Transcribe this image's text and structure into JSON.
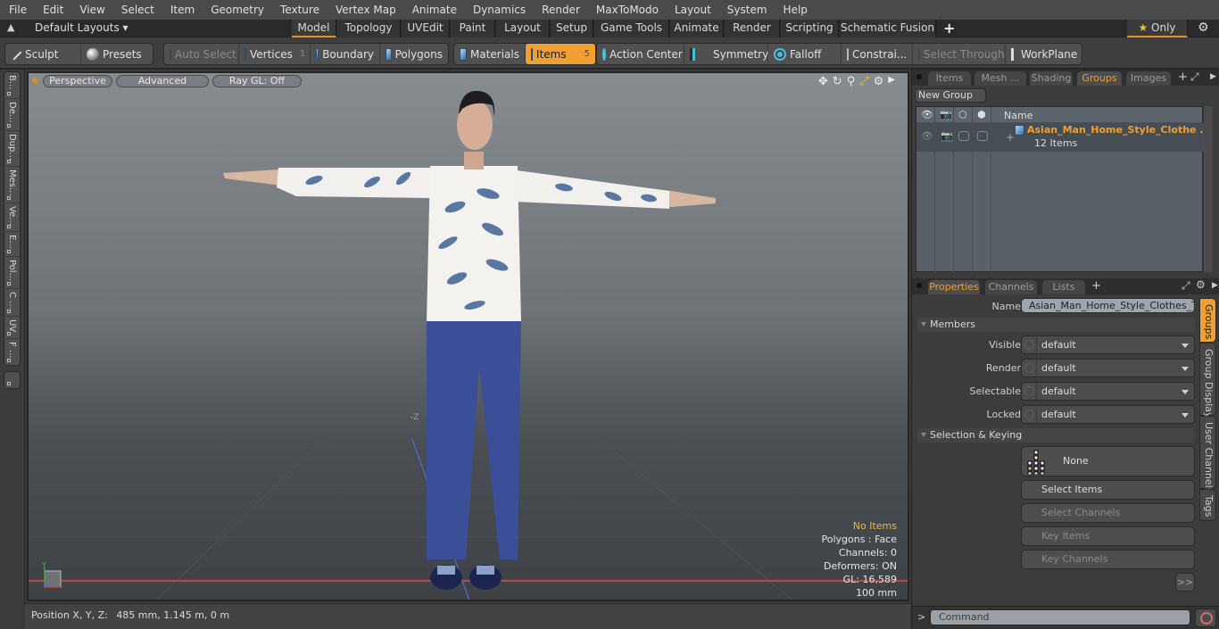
{
  "menu": [
    "File",
    "Edit",
    "View",
    "Select",
    "Item",
    "Geometry",
    "Texture",
    "Vertex Map",
    "Animate",
    "Dynamics",
    "Render",
    "MaxToModo",
    "Layout",
    "System",
    "Help"
  ],
  "layoutbar": {
    "layouts_label": "Default Layouts",
    "tabs": [
      "Model",
      "Topology",
      "UVEdit",
      "Paint",
      "Layout",
      "Setup",
      "Game Tools",
      "Animate",
      "Render",
      "Scripting",
      "Schematic Fusion"
    ],
    "active_tab": "Model",
    "add_label": "+",
    "only_label": "Only"
  },
  "toolbar": {
    "sculpt": "Sculpt",
    "presets": "Presets",
    "auto_select": "Auto Select",
    "vertices": "Vertices",
    "vertices_count": "1",
    "boundary": "Boundary",
    "polygons": "Polygons",
    "materials": "Materials",
    "items": "Items",
    "items_count": "5",
    "action_center": "Action Center",
    "symmetry": "Symmetry",
    "falloff": "Falloff",
    "constraints": "Constrai...",
    "select_through": "Select Through",
    "workplane": "WorkPlane"
  },
  "left_tabs": [
    "B...",
    "De...",
    "Dup...",
    "Mes...",
    "Ve...",
    "E...",
    "Pol...",
    "C ...",
    "UV",
    "F ..."
  ],
  "viewport": {
    "perspective": "Perspective",
    "advanced": "Advanced",
    "raygl": "Ray GL: Off",
    "axis_label": "-Z",
    "hud": {
      "selection": "No Items",
      "polygons": "Polygons : Face",
      "channels": "Channels: 0",
      "deformers": "Deformers: ON",
      "gl": "GL: 16,589",
      "scale": "100 mm"
    }
  },
  "status": {
    "position_label": "Position X, Y, Z:",
    "position_value": "485 mm, 1.145 m, 0 m"
  },
  "top_panel": {
    "tabs": [
      "Items",
      "Mesh ...",
      "Shading",
      "Groups",
      "Images"
    ],
    "active_tab": "Groups",
    "new_group": "New Group",
    "name_header": "Name",
    "group_name": "Asian_Man_Home_Style_Clothe ...",
    "group_count": "12 Items"
  },
  "properties_panel": {
    "tabs": [
      "Properties",
      "Channels",
      "Lists"
    ],
    "active_tab": "Properties",
    "name_label": "Name",
    "name_value": "Asian_Man_Home_Style_Clothes_T_P",
    "members_section": "Members",
    "fields": [
      {
        "label": "Visible",
        "value": "default"
      },
      {
        "label": "Render",
        "value": "default"
      },
      {
        "label": "Selectable",
        "value": "default"
      },
      {
        "label": "Locked",
        "value": "default"
      }
    ],
    "selection_section": "Selection & Keying",
    "none_label": "None",
    "select_items": "Select Items",
    "select_channels": "Select Channels",
    "key_items": "Key Items",
    "key_channels": "Key Channels",
    "more": ">>",
    "side_tabs": [
      "Groups",
      "Group Display",
      "User Channels",
      "Tags"
    ],
    "active_side_tab": "Groups"
  },
  "command": {
    "prompt": ">",
    "placeholder": "Command"
  },
  "colors": {
    "accent": "#f0a030",
    "hud_highlight": "#f1b643",
    "grid_x_axis": "#b24a43"
  }
}
